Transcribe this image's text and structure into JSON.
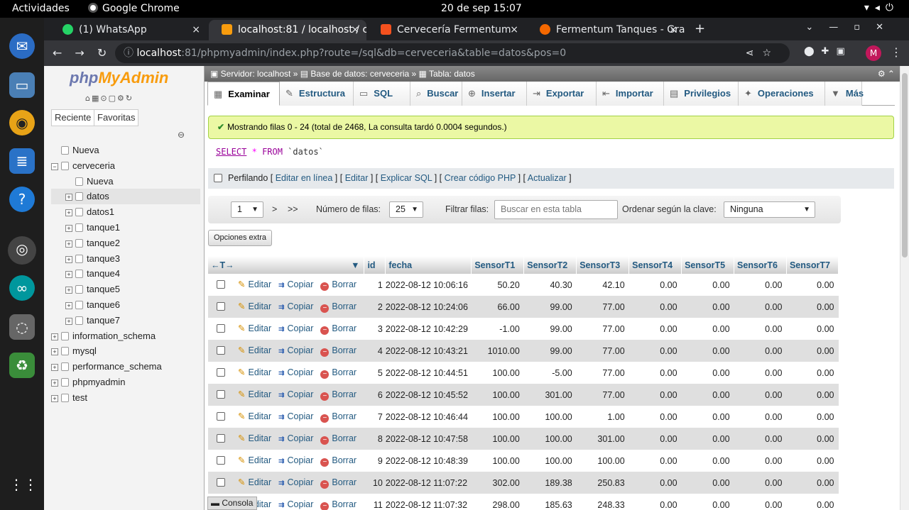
{
  "os": {
    "activities": "Actividades",
    "app_name": "Google Chrome",
    "clock": "20 de sep  15:07"
  },
  "tabs": [
    {
      "title": "(1) WhatsApp",
      "close": "×"
    },
    {
      "title": "localhost:81 / localhost / c",
      "close": "×"
    },
    {
      "title": "Cervecería Fermentum",
      "close": "×"
    },
    {
      "title": "Fermentum Tanques - Gra",
      "close": "×"
    }
  ],
  "browser": {
    "new_tab": "+",
    "url_host": "localhost",
    "url_rest": ":81/phpmyadmin/index.php?route=/sql&db=cerveceria&table=datos&pos=0",
    "avatar": "M"
  },
  "pma": {
    "logo_a": "php",
    "logo_b": "MyAdmin",
    "tab_recent": "Reciente",
    "tab_fav": "Favoritas",
    "tree": [
      {
        "label": "Nueva",
        "level": 0
      },
      {
        "label": "cerveceria",
        "level": 0
      },
      {
        "label": "Nueva",
        "level": 1
      },
      {
        "label": "datos",
        "level": 1
      },
      {
        "label": "datos1",
        "level": 1
      },
      {
        "label": "tanque1",
        "level": 1
      },
      {
        "label": "tanque2",
        "level": 1
      },
      {
        "label": "tanque3",
        "level": 1
      },
      {
        "label": "tanque4",
        "level": 1
      },
      {
        "label": "tanque5",
        "level": 1
      },
      {
        "label": "tanque6",
        "level": 1
      },
      {
        "label": "tanque7",
        "level": 1
      },
      {
        "label": "information_schema",
        "level": 0
      },
      {
        "label": "mysql",
        "level": 0
      },
      {
        "label": "performance_schema",
        "level": 0
      },
      {
        "label": "phpmyadmin",
        "level": 0
      },
      {
        "label": "test",
        "level": 0
      }
    ],
    "breadcrumb": {
      "server": "Servidor: localhost",
      "db": "Base de datos: cerveceria",
      "table": "Tabla: datos"
    },
    "menu": [
      "Examinar",
      "Estructura",
      "SQL",
      "Buscar",
      "Insertar",
      "Exportar",
      "Importar",
      "Privilegios",
      "Operaciones",
      "Más"
    ],
    "success_msg": "Mostrando filas 0 - 24 (total de 2468, La consulta tardó 0.0004 segundos.)",
    "sql": {
      "select": "SELECT",
      "star": "*",
      "from": "FROM",
      "table": "`datos`"
    },
    "profiling": {
      "label": "Perfilando",
      "links": [
        "Editar en línea",
        "Editar",
        "Explicar SQL",
        "Crear código PHP",
        "Actualizar"
      ]
    },
    "nav": {
      "page": "1",
      "next": ">",
      "last": ">>",
      "rows_label": "Número de filas:",
      "rows_value": "25",
      "filter_label": "Filtrar filas:",
      "filter_placeholder": "Buscar en esta tabla",
      "sort_label": "Ordenar según la clave:",
      "sort_value": "Ninguna"
    },
    "extra_options": "Opciones extra",
    "columns": [
      "id",
      "fecha",
      "SensorT1",
      "SensorT2",
      "SensorT3",
      "SensorT4",
      "SensorT5",
      "SensorT6",
      "SensorT7"
    ],
    "action_labels": {
      "edit": "Editar",
      "copy": "Copiar",
      "delete": "Borrar"
    },
    "rows": [
      [
        "1",
        "2022-08-12 10:06:16",
        "50.20",
        "40.30",
        "42.10",
        "0.00",
        "0.00",
        "0.00",
        "0.00"
      ],
      [
        "2",
        "2022-08-12 10:24:06",
        "66.00",
        "99.00",
        "77.00",
        "0.00",
        "0.00",
        "0.00",
        "0.00"
      ],
      [
        "3",
        "2022-08-12 10:42:29",
        "-1.00",
        "99.00",
        "77.00",
        "0.00",
        "0.00",
        "0.00",
        "0.00"
      ],
      [
        "4",
        "2022-08-12 10:43:21",
        "1010.00",
        "99.00",
        "77.00",
        "0.00",
        "0.00",
        "0.00",
        "0.00"
      ],
      [
        "5",
        "2022-08-12 10:44:51",
        "100.00",
        "-5.00",
        "77.00",
        "0.00",
        "0.00",
        "0.00",
        "0.00"
      ],
      [
        "6",
        "2022-08-12 10:45:52",
        "100.00",
        "301.00",
        "77.00",
        "0.00",
        "0.00",
        "0.00",
        "0.00"
      ],
      [
        "7",
        "2022-08-12 10:46:44",
        "100.00",
        "100.00",
        "1.00",
        "0.00",
        "0.00",
        "0.00",
        "0.00"
      ],
      [
        "8",
        "2022-08-12 10:47:58",
        "100.00",
        "100.00",
        "301.00",
        "0.00",
        "0.00",
        "0.00",
        "0.00"
      ],
      [
        "9",
        "2022-08-12 10:48:39",
        "100.00",
        "100.00",
        "100.00",
        "0.00",
        "0.00",
        "0.00",
        "0.00"
      ],
      [
        "10",
        "2022-08-12 11:07:22",
        "302.00",
        "189.38",
        "250.83",
        "0.00",
        "0.00",
        "0.00",
        "0.00"
      ],
      [
        "11",
        "2022-08-12 11:07:32",
        "298.00",
        "185.63",
        "248.33",
        "0.00",
        "0.00",
        "0.00",
        "0.00"
      ]
    ],
    "console": "Consola"
  },
  "colors": {
    "accent": "#235a81",
    "success_bg": "#ebf8a4",
    "delete": "#d9534f"
  }
}
